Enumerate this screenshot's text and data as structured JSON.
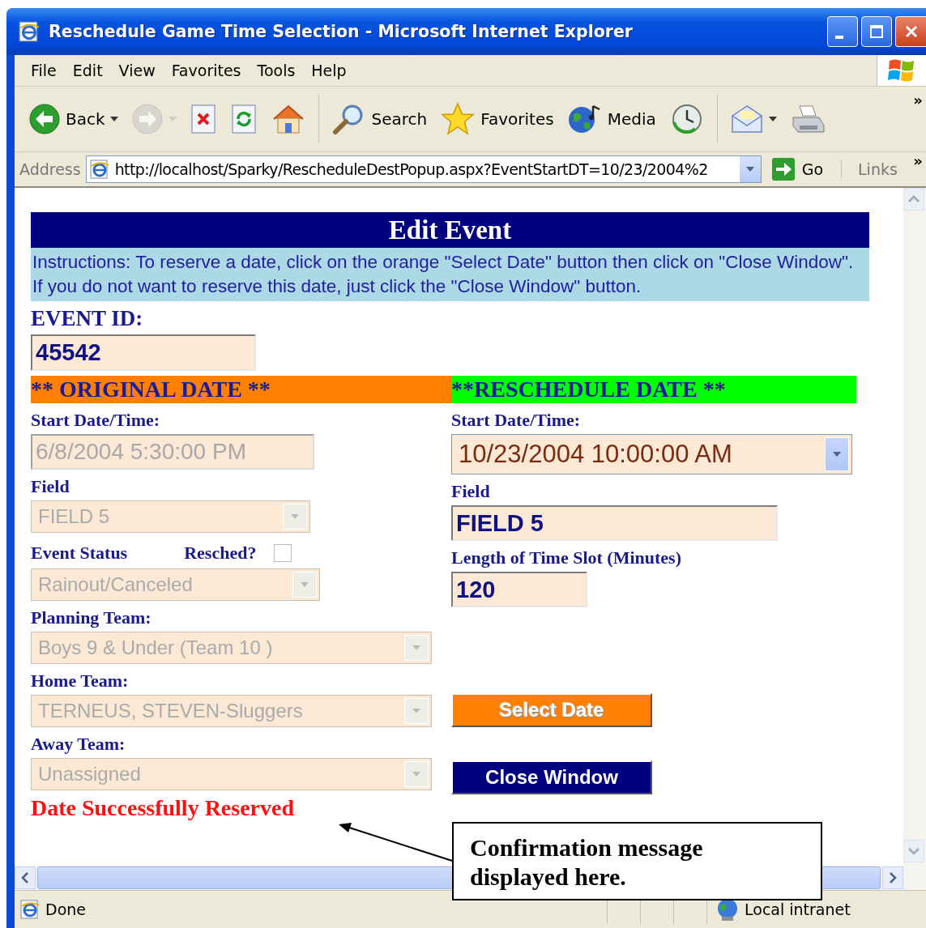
{
  "window": {
    "title": "Reschedule Game Time Selection - Microsoft Internet Explorer"
  },
  "menu": [
    "File",
    "Edit",
    "View",
    "Favorites",
    "Tools",
    "Help"
  ],
  "toolbar": [
    {
      "kind": "back",
      "label": "Back",
      "dropdown": true,
      "disabled": false
    },
    {
      "kind": "forward",
      "dropdown": true,
      "disabled": true
    },
    {
      "kind": "stop",
      "dropdown": false,
      "disabled": false
    },
    {
      "kind": "refresh",
      "dropdown": false,
      "disabled": false
    },
    {
      "kind": "home",
      "dropdown": false,
      "disabled": false
    },
    {
      "kind": "search",
      "label": "Search",
      "dropdown": false,
      "disabled": false
    },
    {
      "kind": "favorites",
      "label": "Favorites",
      "dropdown": false,
      "disabled": false
    },
    {
      "kind": "media",
      "label": "Media",
      "dropdown": false,
      "disabled": false
    },
    {
      "kind": "history",
      "dropdown": false,
      "disabled": false
    },
    {
      "kind": "mail",
      "dropdown": true,
      "disabled": false
    },
    {
      "kind": "print",
      "dropdown": false,
      "disabled": false
    }
  ],
  "toolbar_more": "»",
  "address": {
    "label": "Address",
    "url": "http://localhost/Sparky/RescheduleDestPopup.aspx?EventStartDT=10/23/2004%2",
    "go": "Go",
    "links": "Links",
    "more": "»"
  },
  "page": {
    "title": "Edit Event",
    "instructions": "Instructions: To reserve a date, click on the orange \"Select Date\" button then click on \"Close Window\". If you do not want to reserve this date, just click the \"Close Window\" button.",
    "event_id": {
      "label": "EVENT ID:",
      "value": "45542"
    },
    "original": {
      "heading": "** ORIGINAL DATE **",
      "fields": [
        {
          "label": "Start Date/Time:",
          "kind": "text",
          "value": "6/8/2004 5:30:00 PM",
          "disabled": true
        },
        {
          "label": "Field",
          "kind": "select",
          "value": "FIELD 5",
          "disabled": true
        },
        {
          "label": "Event Status",
          "kind": "select",
          "value": "Rainout/Canceled",
          "disabled": true,
          "checkbox": {
            "label": "Resched?",
            "checked": false
          }
        },
        {
          "label": "Planning Team:",
          "kind": "select",
          "value": "Boys 9 & Under (Team 10 )",
          "disabled": true
        },
        {
          "label": "Home Team:",
          "kind": "select",
          "value": "TERNEUS, STEVEN-Sluggers",
          "disabled": true
        },
        {
          "label": "Away Team:",
          "kind": "select",
          "value": "Unassigned",
          "disabled": true
        }
      ]
    },
    "reschedule": {
      "heading": "**RESCHEDULE DATE **",
      "fields": [
        {
          "label": "Start Date/Time:",
          "kind": "select",
          "value": "10/23/2004 10:00:00 AM",
          "disabled": false
        },
        {
          "label": "Field",
          "kind": "text",
          "value": "FIELD 5",
          "disabled": false
        },
        {
          "label": "Length of Time Slot (Minutes)",
          "kind": "text",
          "value": "120",
          "disabled": false
        }
      ]
    },
    "buttons": [
      {
        "kind": "select",
        "label": "Select Date"
      },
      {
        "kind": "close",
        "label": "Close Window"
      }
    ],
    "message": "Date Successfully Reserved"
  },
  "status_bar": {
    "text": "Done",
    "zone": "Local intranet"
  },
  "annotation": {
    "text": "Confirmation message displayed here."
  }
}
